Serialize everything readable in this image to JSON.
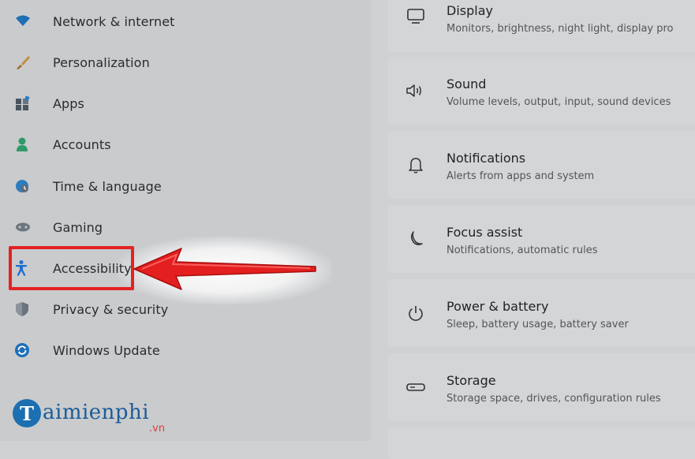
{
  "sidebar": {
    "items": [
      {
        "label": "Network & internet",
        "icon": "wifi-icon"
      },
      {
        "label": "Personalization",
        "icon": "brush-icon"
      },
      {
        "label": "Apps",
        "icon": "apps-icon"
      },
      {
        "label": "Accounts",
        "icon": "person-icon"
      },
      {
        "label": "Time & language",
        "icon": "globe-clock-icon"
      },
      {
        "label": "Gaming",
        "icon": "gamepad-icon"
      },
      {
        "label": "Accessibility",
        "icon": "accessibility-icon"
      },
      {
        "label": "Privacy & security",
        "icon": "shield-icon"
      },
      {
        "label": "Windows Update",
        "icon": "update-icon"
      }
    ]
  },
  "annotation": {
    "highlight_color": "#e52222"
  },
  "watermark": {
    "brand": "aimienphi",
    "mark": "T",
    "tld": ".vn"
  },
  "settings": {
    "cards": [
      {
        "title": "Display",
        "subtitle": "Monitors, brightness, night light, display pro",
        "icon": "monitor-icon"
      },
      {
        "title": "Sound",
        "subtitle": "Volume levels, output, input, sound devices",
        "icon": "speaker-icon"
      },
      {
        "title": "Notifications",
        "subtitle": "Alerts from apps and system",
        "icon": "bell-icon"
      },
      {
        "title": "Focus assist",
        "subtitle": "Notifications, automatic rules",
        "icon": "moon-icon"
      },
      {
        "title": "Power & battery",
        "subtitle": "Sleep, battery usage, battery saver",
        "icon": "power-icon"
      },
      {
        "title": "Storage",
        "subtitle": "Storage space, drives, configuration rules",
        "icon": "drive-icon"
      }
    ]
  }
}
